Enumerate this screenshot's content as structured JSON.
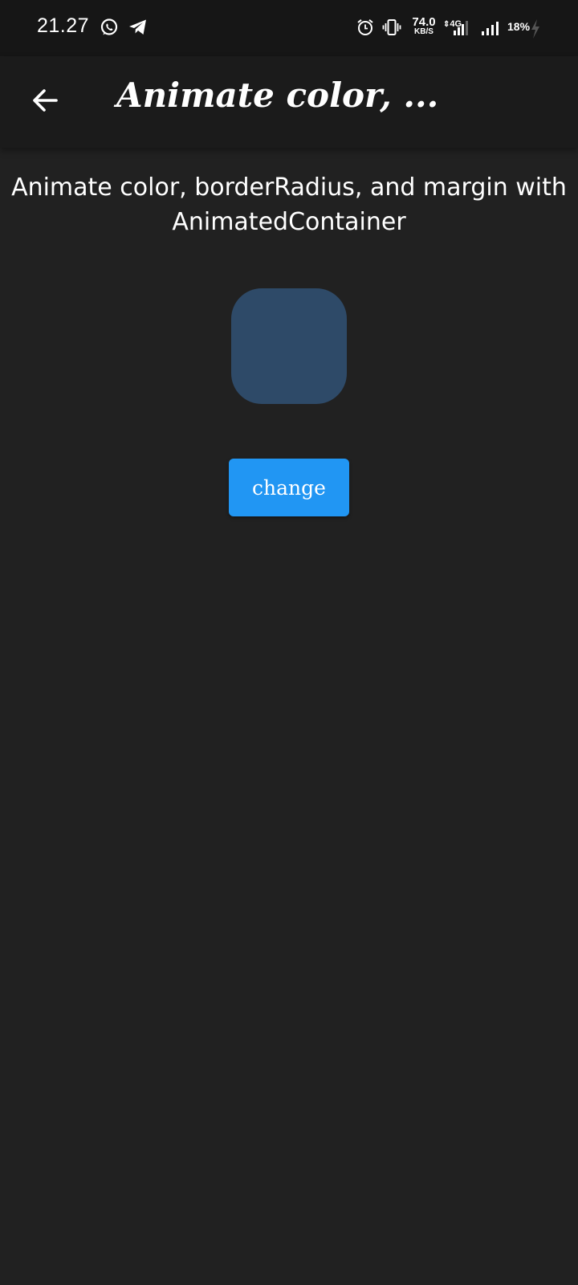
{
  "status_bar": {
    "time": "21.27",
    "net_speed_value": "74.0",
    "net_speed_unit": "KB/S",
    "net_type": "4G",
    "battery": "18%",
    "icons": [
      "whatsapp-icon",
      "telegram-icon",
      "alarm-icon",
      "vibrate-icon",
      "signal-icon",
      "signal-icon",
      "charging-icon"
    ]
  },
  "app_bar": {
    "title": "Animate color, ...",
    "back_icon": "arrow-left-icon"
  },
  "main": {
    "description": "Animate color,  borderRadius,  and margin with AnimatedContainer",
    "box_color": "#2e4a68",
    "button_label": "change",
    "button_color": "#2196f3"
  },
  "colors": {
    "background": "#212121",
    "app_bar": "#1b1b1b",
    "status_bar": "#161616"
  }
}
